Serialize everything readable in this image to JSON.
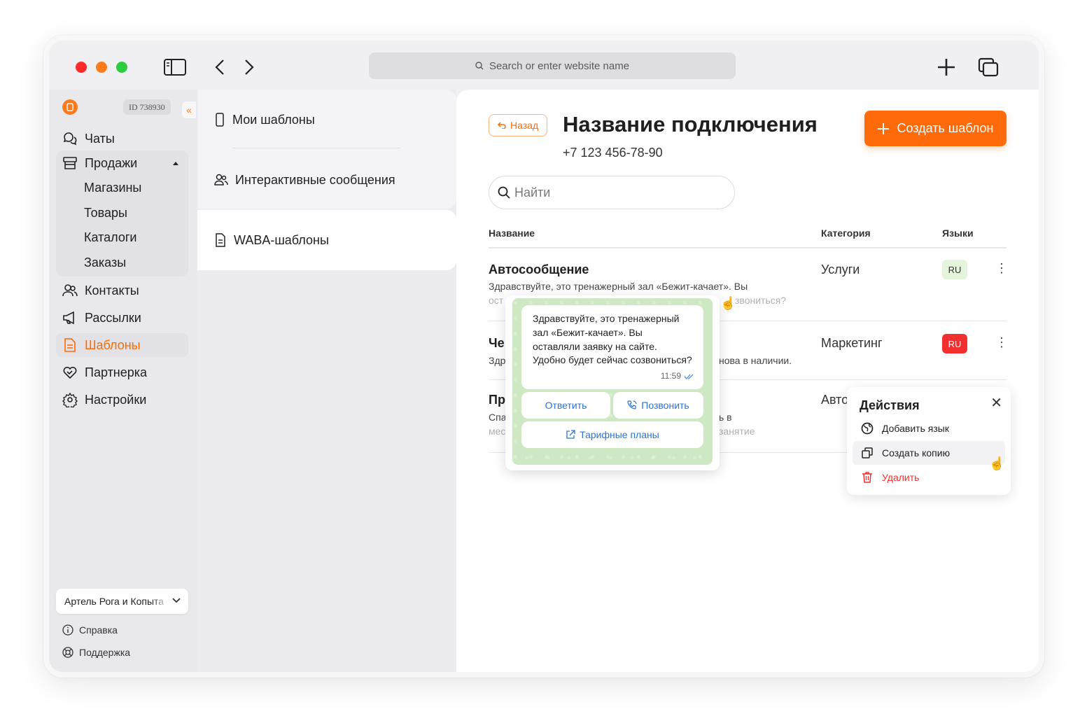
{
  "browser": {
    "url_placeholder": "Search or enter website name"
  },
  "sidebar": {
    "account_id": "ID 738930",
    "collapse_glyph": "«",
    "items": [
      {
        "label": "Чаты",
        "icon": "chat-icon"
      },
      {
        "label": "Продажи",
        "icon": "store-icon"
      },
      {
        "label": "Контакты",
        "icon": "contacts-icon"
      },
      {
        "label": "Рассылки",
        "icon": "megaphone-icon"
      },
      {
        "label": "Шаблоны",
        "icon": "document-icon",
        "active": true
      },
      {
        "label": "Партнерка",
        "icon": "heart-handshake-icon"
      },
      {
        "label": "Настройки",
        "icon": "gear-icon"
      }
    ],
    "sales_subitems": [
      "Магазины",
      "Товары",
      "Каталоги",
      "Заказы"
    ],
    "organization": "Артель Рога и Копыта",
    "footer": [
      {
        "label": "Справка",
        "icon": "info-icon"
      },
      {
        "label": "Поддержка",
        "icon": "lifebuoy-icon"
      }
    ]
  },
  "templates_nav": {
    "items": [
      {
        "label": "Мои шаблоны",
        "icon": "phone-icon"
      },
      {
        "label": "Интерактивные сообщения",
        "icon": "users-icon"
      },
      {
        "label": "WABA-шаблоны",
        "icon": "file-icon",
        "active": true
      }
    ]
  },
  "header": {
    "back_label": "Назад",
    "title": "Название подключения",
    "phone": "+7 123 456-78-90",
    "create_label": "Создать шаблон"
  },
  "search": {
    "placeholder": "Найти"
  },
  "table": {
    "columns": [
      "Название",
      "Категория",
      "Языки"
    ],
    "rows": [
      {
        "title": "Автосообщение",
        "desc": "Здравствуйте, это тренажерный зал «Бежит-качает». Вы",
        "desc_tail_left": "ост",
        "desc_tail_right": "звониться?",
        "category": "Услуги",
        "lang": "RU",
        "lang_status": "approved"
      },
      {
        "title_fragment": "Че",
        "desc_fragment": "Здр",
        "desc_right": "нова в наличии.",
        "category": "Маркетинг",
        "lang": "RU",
        "lang_status": "rejected"
      },
      {
        "title_fragment": "Пр",
        "desc_fragment": "Спа",
        "desc_tail_left": "мес",
        "desc_right": "ь в",
        "desc_tail_right": "занятие",
        "category_fragment": "Авто"
      }
    ]
  },
  "preview": {
    "message": "Здравствуйте, это тренажерный зал «Бежит-качает». Вы оставляли заявку на сайте. Удобно будет сейчас созвониться?",
    "time": "11:59",
    "buttons": {
      "reply": "Ответить",
      "call": "Позвонить",
      "link": "Тарифные планы"
    }
  },
  "actions_menu": {
    "title": "Действия",
    "items": [
      {
        "label": "Добавить язык",
        "icon": "globe-icon"
      },
      {
        "label": "Создать копию",
        "icon": "copy-icon"
      },
      {
        "label": "Удалить",
        "icon": "trash-icon",
        "danger": true
      }
    ]
  },
  "colors": {
    "accent": "#ff6a0a",
    "danger": "#f23030",
    "link": "#2a74d6",
    "approved_bg": "#e4f5dc"
  }
}
